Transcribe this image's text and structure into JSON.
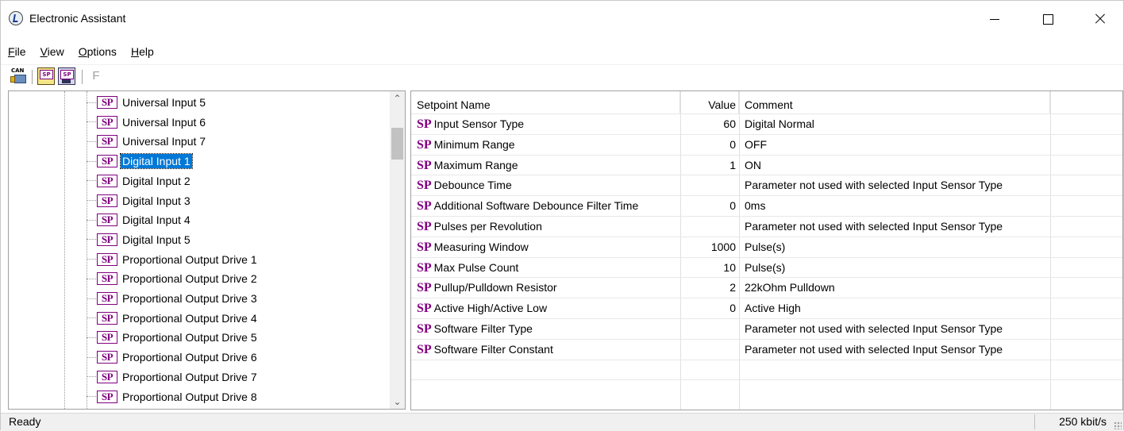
{
  "window": {
    "title": "Electronic Assistant",
    "icon": "app-logo-icon"
  },
  "menu": [
    {
      "label": "File",
      "accel": "F",
      "rest": "ile"
    },
    {
      "label": "View",
      "accel": "V",
      "rest": "iew"
    },
    {
      "label": "Options",
      "accel": "O",
      "rest": "ptions"
    },
    {
      "label": "Help",
      "accel": "H",
      "rest": "elp"
    }
  ],
  "toolbar": {
    "can_icon_label": "CAN",
    "sp_label": "SP",
    "f_label": "F"
  },
  "tree": {
    "icon_label": "SP",
    "items": [
      {
        "label": "Universal Input 5",
        "selected": false
      },
      {
        "label": "Universal Input 6",
        "selected": false
      },
      {
        "label": "Universal Input 7",
        "selected": false
      },
      {
        "label": "Digital Input 1",
        "selected": true
      },
      {
        "label": "Digital Input 2",
        "selected": false
      },
      {
        "label": "Digital Input 3",
        "selected": false
      },
      {
        "label": "Digital Input 4",
        "selected": false
      },
      {
        "label": "Digital Input 5",
        "selected": false
      },
      {
        "label": "Proportional Output Drive 1",
        "selected": false
      },
      {
        "label": "Proportional Output Drive 2",
        "selected": false
      },
      {
        "label": "Proportional Output Drive 3",
        "selected": false
      },
      {
        "label": "Proportional Output Drive 4",
        "selected": false
      },
      {
        "label": "Proportional Output Drive 5",
        "selected": false
      },
      {
        "label": "Proportional Output Drive 6",
        "selected": false
      },
      {
        "label": "Proportional Output Drive 7",
        "selected": false
      },
      {
        "label": "Proportional Output Drive 8",
        "selected": false
      }
    ]
  },
  "grid": {
    "headers": {
      "name": "Setpoint Name",
      "value": "Value",
      "comment": "Comment"
    },
    "sp_tag": "SP",
    "rows": [
      {
        "name": "Input Sensor Type",
        "value": "60",
        "comment": "Digital Normal"
      },
      {
        "name": "Minimum Range",
        "value": "0",
        "comment": "OFF"
      },
      {
        "name": "Maximum Range",
        "value": "1",
        "comment": "ON"
      },
      {
        "name": "Debounce Time",
        "value": "",
        "comment": "Parameter not used with selected Input Sensor Type"
      },
      {
        "name": "Additional Software Debounce Filter Time",
        "value": "0",
        "comment": "0ms"
      },
      {
        "name": "Pulses per Revolution",
        "value": "",
        "comment": "Parameter not used with selected Input Sensor Type"
      },
      {
        "name": "Measuring Window",
        "value": "1000",
        "comment": "Pulse(s)"
      },
      {
        "name": "Max Pulse Count",
        "value": "10",
        "comment": "Pulse(s)"
      },
      {
        "name": "Pullup/Pulldown Resistor",
        "value": "2",
        "comment": "22kOhm Pulldown"
      },
      {
        "name": "Active High/Active Low",
        "value": "0",
        "comment": "Active High"
      },
      {
        "name": "Software Filter Type",
        "value": "",
        "comment": "Parameter not used with selected Input Sensor Type"
      },
      {
        "name": "Software Filter Constant",
        "value": "",
        "comment": "Parameter not used with selected Input Sensor Type"
      }
    ]
  },
  "status": {
    "text": "Ready",
    "rate": "250 kbit/s"
  },
  "colors": {
    "sp_purple": "#800080",
    "selection": "#0078d7"
  }
}
